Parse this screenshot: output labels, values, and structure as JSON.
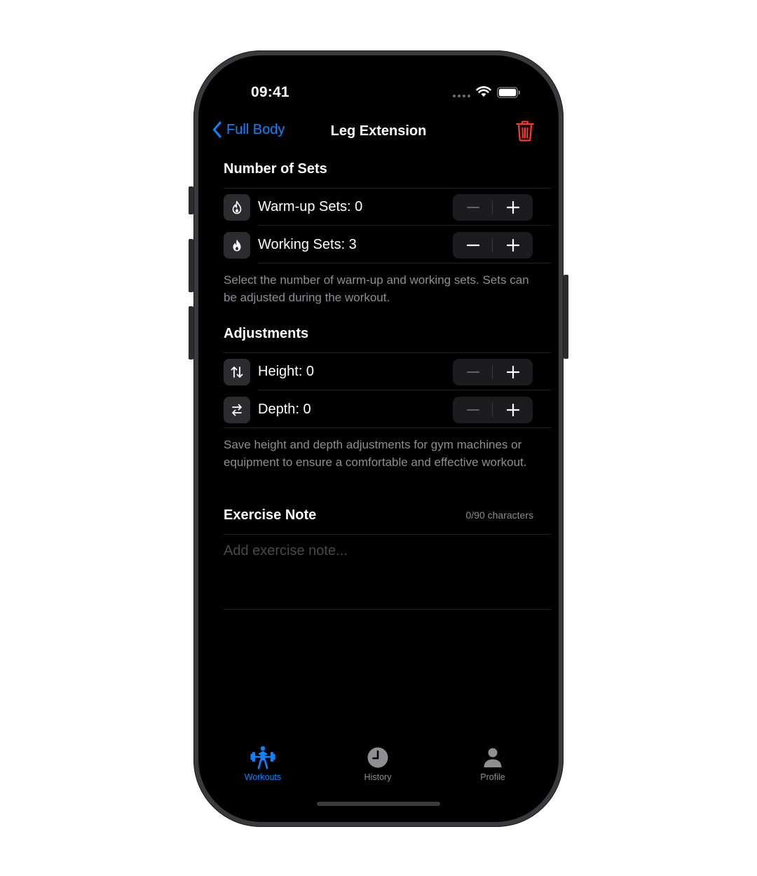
{
  "status_bar": {
    "time": "09:41"
  },
  "nav": {
    "back_label": "Full Body",
    "title": "Leg Extension",
    "back_icon": "chevron-left-icon",
    "delete_icon": "trash-icon"
  },
  "sets_section": {
    "header": "Number of Sets",
    "rows": [
      {
        "label": "Warm-up Sets: 0",
        "icon": "flame-outline-icon"
      },
      {
        "label": "Working Sets: 3",
        "icon": "flame-filled-icon"
      }
    ],
    "footer": "Select the number of warm-up and working sets. Sets can be adjusted during the workout."
  },
  "adjustments_section": {
    "header": "Adjustments",
    "rows": [
      {
        "label": "Height: 0",
        "icon": "arrows-up-down-icon"
      },
      {
        "label": "Depth: 0",
        "icon": "arrows-left-right-icon"
      }
    ],
    "footer": "Save height and depth adjustments for gym machines or equipment to ensure a comfortable and effective workout."
  },
  "note_section": {
    "header": "Exercise Note",
    "char_count": "0/90 characters",
    "placeholder": "Add exercise note..."
  },
  "tab_bar": {
    "tabs": [
      {
        "label": "Workouts",
        "icon": "weightlifter-icon",
        "selected": true
      },
      {
        "label": "History",
        "icon": "clock-icon",
        "selected": false
      },
      {
        "label": "Profile",
        "icon": "person-icon",
        "selected": false
      }
    ]
  },
  "colors": {
    "accent": "#0a84ff",
    "destructive": "#ff3b30",
    "background": "#000000",
    "secondary_text": "#8e8e93"
  }
}
